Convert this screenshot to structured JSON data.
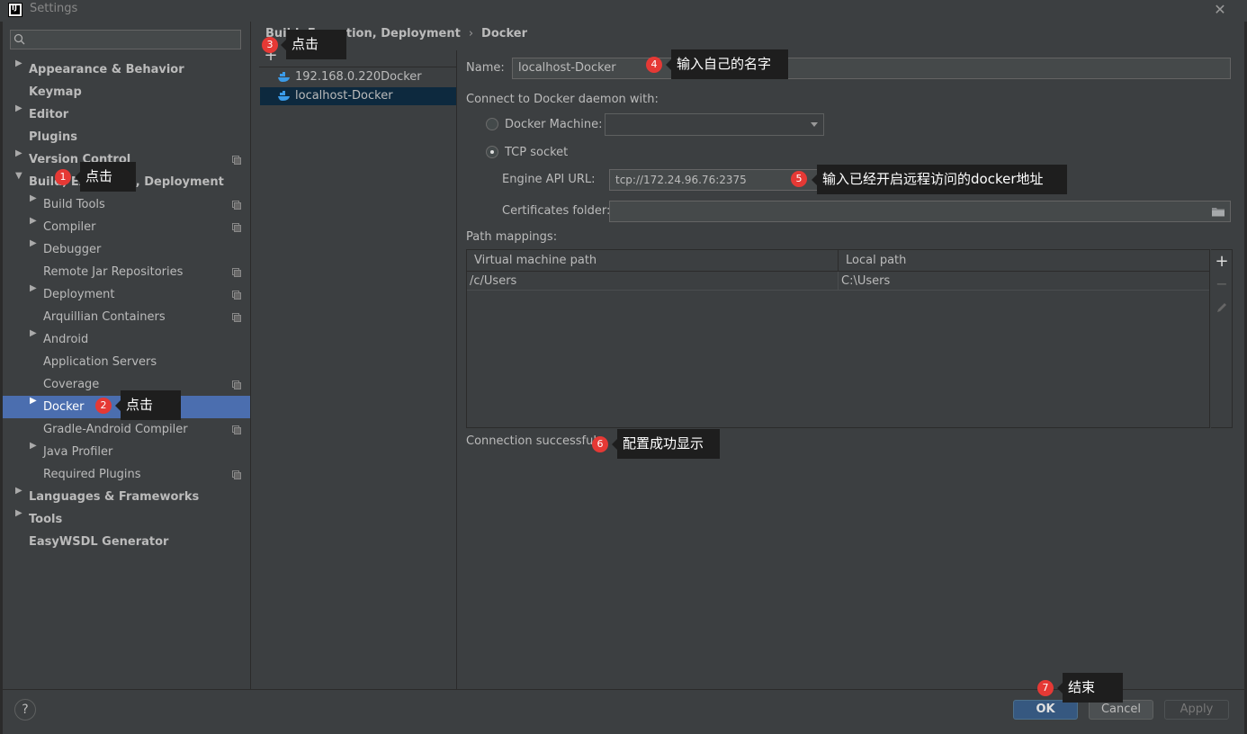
{
  "window": {
    "title": "Settings"
  },
  "search": {
    "placeholder": ""
  },
  "breadcrumb": {
    "parent": "Build, Execution, Deployment",
    "current": "Docker"
  },
  "sidebar": {
    "items": [
      {
        "label": "Appearance & Behavior",
        "bold": true,
        "arrow": "right"
      },
      {
        "label": "Keymap",
        "bold": true
      },
      {
        "label": "Editor",
        "bold": true,
        "arrow": "right"
      },
      {
        "label": "Plugins",
        "bold": true
      },
      {
        "label": "Version Control",
        "bold": true,
        "arrow": "right"
      },
      {
        "label": "Build, Execution, Deployment",
        "bold": true,
        "arrow": "down"
      },
      {
        "label": "Build Tools",
        "arrow": "right"
      },
      {
        "label": "Compiler",
        "arrow": "right"
      },
      {
        "label": "Debugger",
        "arrow": "right"
      },
      {
        "label": "Remote Jar Repositories"
      },
      {
        "label": "Deployment",
        "arrow": "right"
      },
      {
        "label": "Arquillian Containers"
      },
      {
        "label": "Android",
        "arrow": "right"
      },
      {
        "label": "Application Servers"
      },
      {
        "label": "Coverage"
      },
      {
        "label": "Docker",
        "arrow": "right",
        "selected": true
      },
      {
        "label": "Gradle-Android Compiler"
      },
      {
        "label": "Java Profiler",
        "arrow": "right"
      },
      {
        "label": "Required Plugins"
      },
      {
        "label": "Languages & Frameworks",
        "bold": true,
        "arrow": "right"
      },
      {
        "label": "Tools",
        "bold": true,
        "arrow": "right"
      },
      {
        "label": "EasyWSDL Generator",
        "bold": true
      }
    ]
  },
  "docker_list": {
    "add_label": "+",
    "remove_label": "−",
    "entries": [
      "192.168.0.220Docker",
      "localhost-Docker"
    ]
  },
  "form": {
    "name_label": "Name:",
    "name_value": "localhost-Docker",
    "connect_label": "Connect to Docker daemon with:",
    "docker_machine_label": "Docker Machine:",
    "docker_machine_value": "",
    "tcp_label": "TCP socket",
    "engine_url_label": "Engine API URL:",
    "engine_url_value": "tcp://172.24.96.76:2375",
    "cert_label": "Certificates folder:",
    "cert_value": "",
    "path_mappings_label": "Path mappings:",
    "table": {
      "headers": [
        "Virtual machine path",
        "Local path"
      ],
      "rows": [
        [
          "/c/Users",
          "C:\\Users"
        ]
      ]
    },
    "status": "Connection successful"
  },
  "buttons": {
    "help": "?",
    "ok": "OK",
    "cancel": "Cancel",
    "apply": "Apply"
  },
  "annotations": [
    {
      "num": "1",
      "text": "点击"
    },
    {
      "num": "2",
      "text": "点击"
    },
    {
      "num": "3",
      "text": "点击"
    },
    {
      "num": "4",
      "text": "输入自己的名字"
    },
    {
      "num": "5",
      "text": "输入已经开启远程访问的docker地址"
    },
    {
      "num": "6",
      "text": "配置成功显示"
    },
    {
      "num": "7",
      "text": "结束"
    }
  ],
  "colors": {
    "background": "#3c3f41",
    "selection": "#4b6eaf",
    "ok_button": "#365880",
    "annotation_badge": "#e53935"
  }
}
